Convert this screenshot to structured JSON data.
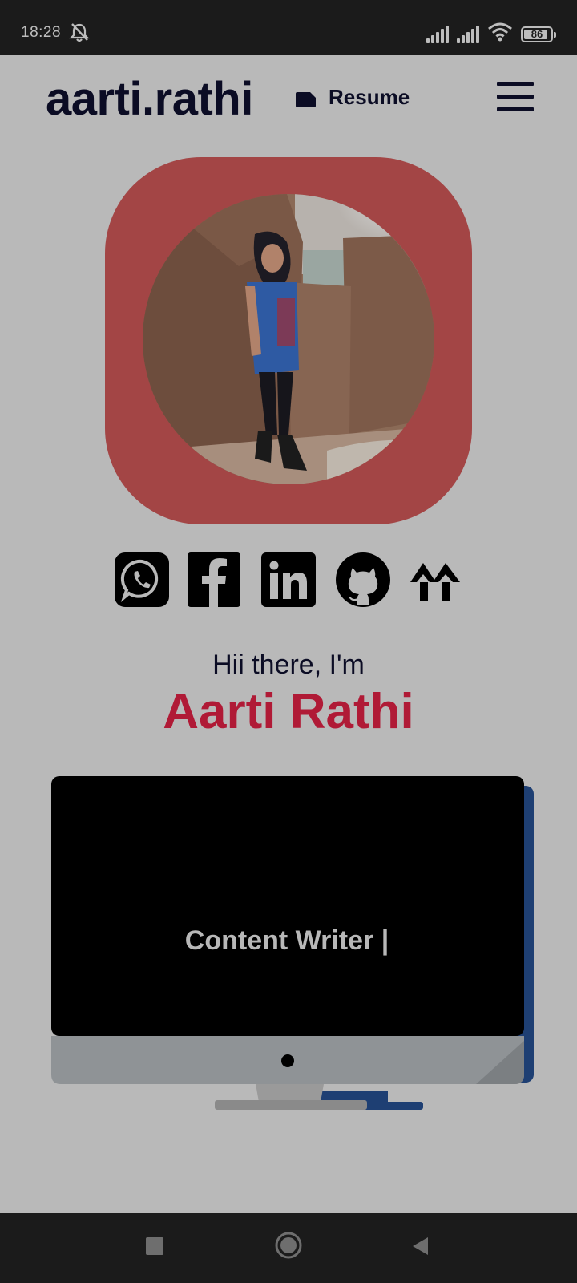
{
  "status_bar": {
    "time": "18:28",
    "battery": "86"
  },
  "header": {
    "logo": "aarti.rathi",
    "resume_label": "Resume"
  },
  "social_icons": [
    "whatsapp-icon",
    "facebook-icon",
    "linkedin-icon",
    "github-icon",
    "linktree-icon"
  ],
  "hero": {
    "greeting": "Hii there, I'm",
    "name": "Aarti Rathi"
  },
  "monitor": {
    "typed_text": "Content Writer |"
  },
  "colors": {
    "background": "#b9b9b9",
    "logo": "#0b0c24",
    "accent_frame": "#a34545",
    "name": "#b01a36",
    "monitor_shadow": "#1e3f73"
  }
}
